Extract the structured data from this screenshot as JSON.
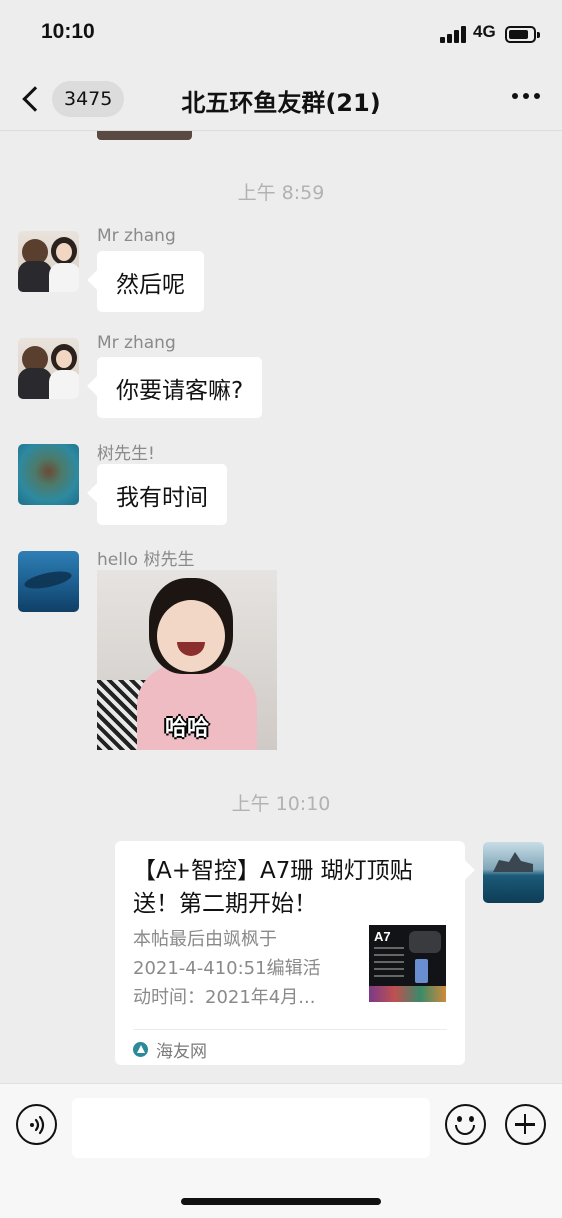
{
  "status_bar": {
    "time": "10:10",
    "network": "4G"
  },
  "nav": {
    "badge_count": "3475",
    "title": "北五环鱼友群(21)"
  },
  "messages": {
    "timestamp_1": "上午 8:59",
    "m1": {
      "sender": "Mr zhang",
      "text": "然后呢"
    },
    "m2": {
      "sender": "Mr zhang",
      "text": "你要请客嘛?"
    },
    "m3": {
      "sender": "树先生!",
      "text": "我有时间"
    },
    "m4": {
      "sender": "hello 树先生",
      "image_caption": "哈哈"
    },
    "timestamp_2": "上午 10:10",
    "card": {
      "title": "【A+智控】A7珊 瑚灯顶贴送！第二期开始！",
      "desc_line1": "本帖最后由飒枫于",
      "desc_line2": "2021-4-410:51编辑活",
      "desc_line3": "动时间：2021年4月...",
      "thumb_label": "A7",
      "source": "海友网"
    }
  },
  "input": {
    "placeholder": ""
  },
  "icons": {
    "back": "chevron-left-icon",
    "more": "more-dots-icon",
    "voice": "voice-icon",
    "emoji": "emoji-icon",
    "plus": "plus-icon"
  },
  "colors": {
    "background": "#ededed",
    "bubble": "#ffffff",
    "timestamp": "#b2b2b2"
  }
}
